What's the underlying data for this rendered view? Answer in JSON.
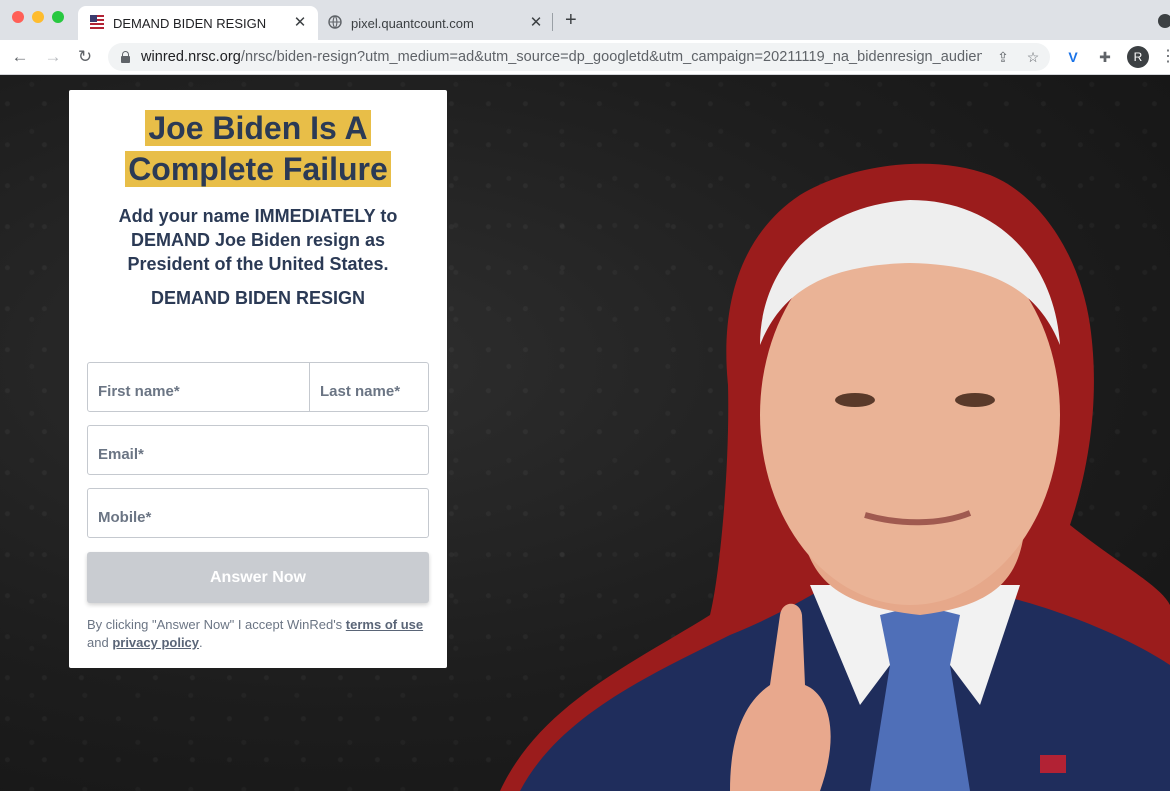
{
  "browser": {
    "tabs": [
      {
        "title": "DEMAND BIDEN RESIGN",
        "active": true
      },
      {
        "title": "pixel.quantcount.com",
        "active": false
      }
    ],
    "address": {
      "host": "winred.nrsc.org",
      "path": "/nrsc/biden-resign?utm_medium=ad&utm_source=dp_googletd&utm_campaign=20211119_na_bidenresign_audien..."
    },
    "profile_initial": "R",
    "icons": {
      "back": "back-arrow-icon",
      "forward": "forward-arrow-icon",
      "reload": "reload-icon",
      "share": "share-icon",
      "bookmark": "star-icon",
      "extension1": "v-extension-icon",
      "extensions": "puzzle-icon",
      "menu": "kebab-menu-icon"
    }
  },
  "form": {
    "headline": "Joe Biden Is A Complete Failure",
    "subtext": "Add your name IMMEDIATELY to DEMAND Joe Biden resign as President of the United States.",
    "subhead": "DEMAND BIDEN RESIGN",
    "first_name_placeholder": "First name*",
    "last_name_placeholder": "Last name*",
    "email_placeholder": "Email*",
    "mobile_placeholder": "Mobile*",
    "submit_label": "Answer Now",
    "legal_prefix": "By clicking \"Answer Now\" I accept WinRed's ",
    "terms_link": "terms of use",
    "legal_and": " and ",
    "privacy_link": "privacy policy",
    "legal_suffix": "."
  },
  "colors": {
    "highlight": "#e8be48",
    "navy": "#2b3a55",
    "button_disabled": "#c9ccd1"
  }
}
